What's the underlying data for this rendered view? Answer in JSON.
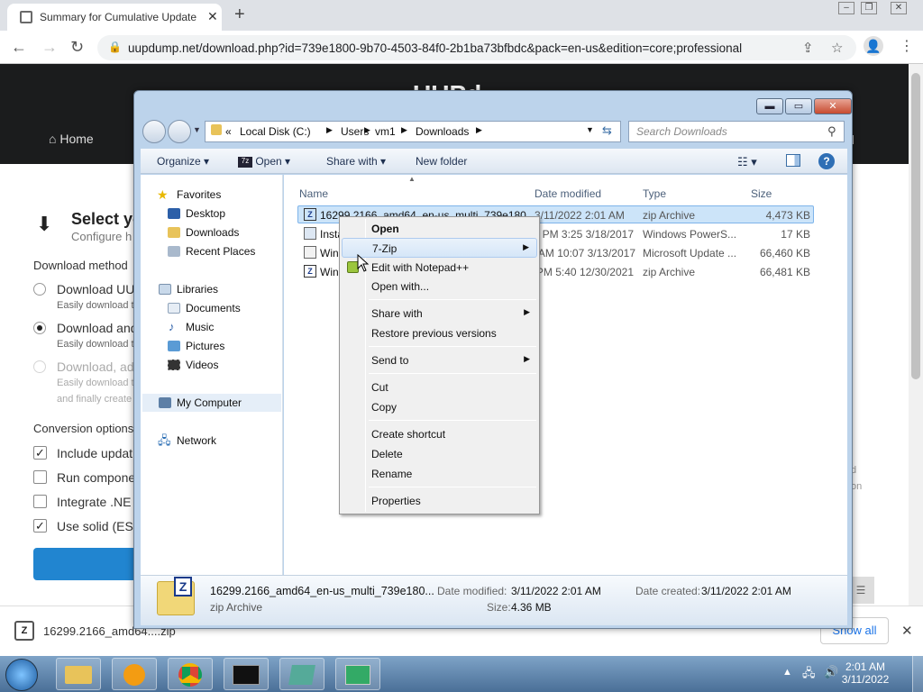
{
  "browser": {
    "tab_title": "Summary for Cumulative Update",
    "url": "uupdump.net/download.php?id=739e1800-9b70-4503-84f0-2b1ba73bfbdc&pack=en-us&edition=core;professional"
  },
  "site": {
    "logo_text": "UUPd",
    "nav_home": "Home",
    "heading": "Select yo",
    "subheading": "Configure h",
    "download_method_label": "Download method",
    "options": [
      {
        "label": "Download UU",
        "desc": "Easily download t",
        "selected": false
      },
      {
        "label": "Download and",
        "desc": "Easily download t",
        "selected": true
      },
      {
        "label": "Download, ad",
        "desc": "Easily download t",
        "desc2": "and finally create",
        "selected": false
      }
    ],
    "conversion_label": "Conversion options",
    "checkboxes": [
      {
        "label": "Include updat",
        "checked": true
      },
      {
        "label": "Run compone",
        "checked": false
      },
      {
        "label": "Integrate .NE",
        "checked": false
      },
      {
        "label": "Use solid (ESD",
        "checked": true
      }
    ],
    "right_fragment_1": "d",
    "right_fragment_2": "on",
    "right_nav_fragment": "d"
  },
  "shelf": {
    "file_name": "16299.2166_amd64....zip",
    "show_all": "Show all"
  },
  "explorer": {
    "breadcrumb": [
      "Local Disk (C:)",
      "Users",
      "vm1",
      "Downloads"
    ],
    "search_placeholder": "Search Downloads",
    "toolbar": {
      "organize": "Organize",
      "open": "Open",
      "share_with": "Share with",
      "new_folder": "New folder"
    },
    "nav": {
      "favorites": "Favorites",
      "favorites_items": [
        "Desktop",
        "Downloads",
        "Recent Places"
      ],
      "libraries": "Libraries",
      "libraries_items": [
        "Documents",
        "Music",
        "Pictures",
        "Videos"
      ],
      "computer": "My Computer",
      "network": "Network"
    },
    "columns": {
      "name": "Name",
      "date": "Date modified",
      "type": "Type",
      "size": "Size"
    },
    "files": [
      {
        "name": "16299.2166_amd64_en-us_multi_739e180...",
        "date": "3/11/2022 2:01 AM",
        "type": "zip Archive",
        "size": "4,473 KB"
      },
      {
        "name": "Insta",
        "date": "3/18/2017 3:25 PM",
        "type": "Windows PowerS...",
        "size": "17 KB"
      },
      {
        "name": "Win7",
        "date": "3/13/2017 10:07 AM",
        "type": "Microsoft Update ...",
        "size": "66,460 KB"
      },
      {
        "name": "Win7",
        "date": "12/30/2021 5:40 PM",
        "type": "zip Archive",
        "size": "66,481 KB"
      }
    ],
    "details": {
      "file_name": "16299.2166_amd64_en-us_multi_739e180...",
      "file_type": "zip Archive",
      "date_modified_label": "Date modified:",
      "date_modified": "3/11/2022 2:01 AM",
      "size_label": "Size:",
      "size": "4.36 MB",
      "date_created_label": "Date created:",
      "date_created": "3/11/2022 2:01 AM"
    }
  },
  "context_menu": {
    "open": "Open",
    "seven_zip": "7-Zip",
    "edit_notepad": "Edit with Notepad++",
    "open_with": "Open with...",
    "share_with": "Share with",
    "restore": "Restore previous versions",
    "send_to": "Send to",
    "cut": "Cut",
    "copy": "Copy",
    "create_shortcut": "Create shortcut",
    "delete": "Delete",
    "rename": "Rename",
    "properties": "Properties"
  },
  "taskbar": {
    "time": "2:01 AM",
    "date": "3/11/2022"
  }
}
